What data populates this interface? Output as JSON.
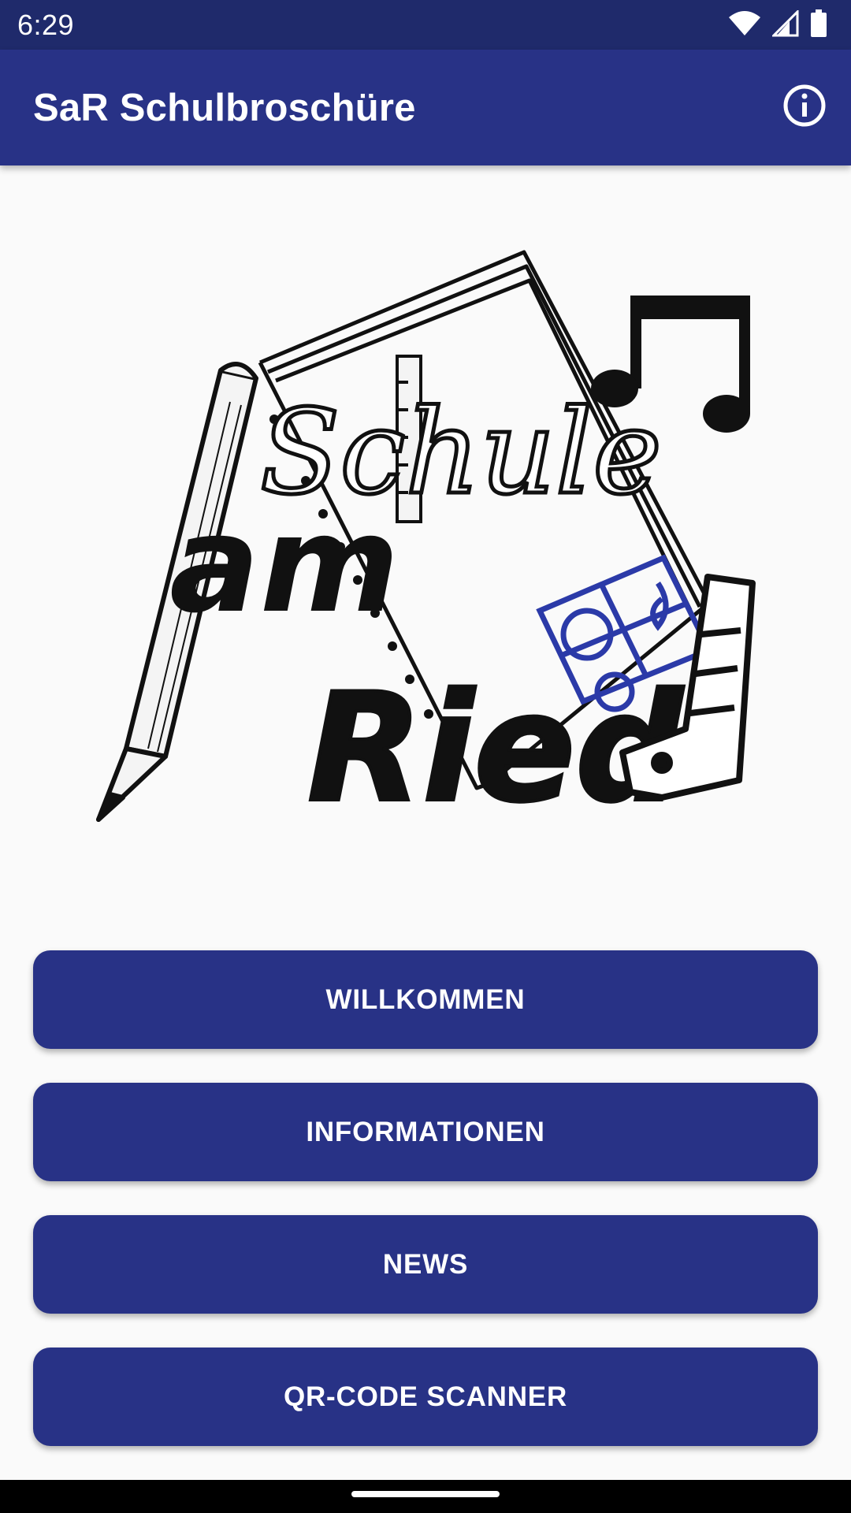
{
  "status_bar": {
    "time": "6:29",
    "icons": [
      "wifi-icon",
      "signal-icon",
      "battery-icon"
    ]
  },
  "app_bar": {
    "title": "SaR Schulbroschüre",
    "info_icon": "info-icon"
  },
  "logo": {
    "text_line1": "Schule",
    "text_line2": "am",
    "text_line3": "Ried"
  },
  "buttons": [
    {
      "label": "WILLKOMMEN"
    },
    {
      "label": "INFORMATIONEN"
    },
    {
      "label": "NEWS"
    },
    {
      "label": "QR-CODE SCANNER"
    }
  ],
  "colors": {
    "status_bar": "#1f2a6b",
    "primary": "#283286",
    "background": "#fafafa",
    "accent_blue": "#2b3aa8"
  }
}
